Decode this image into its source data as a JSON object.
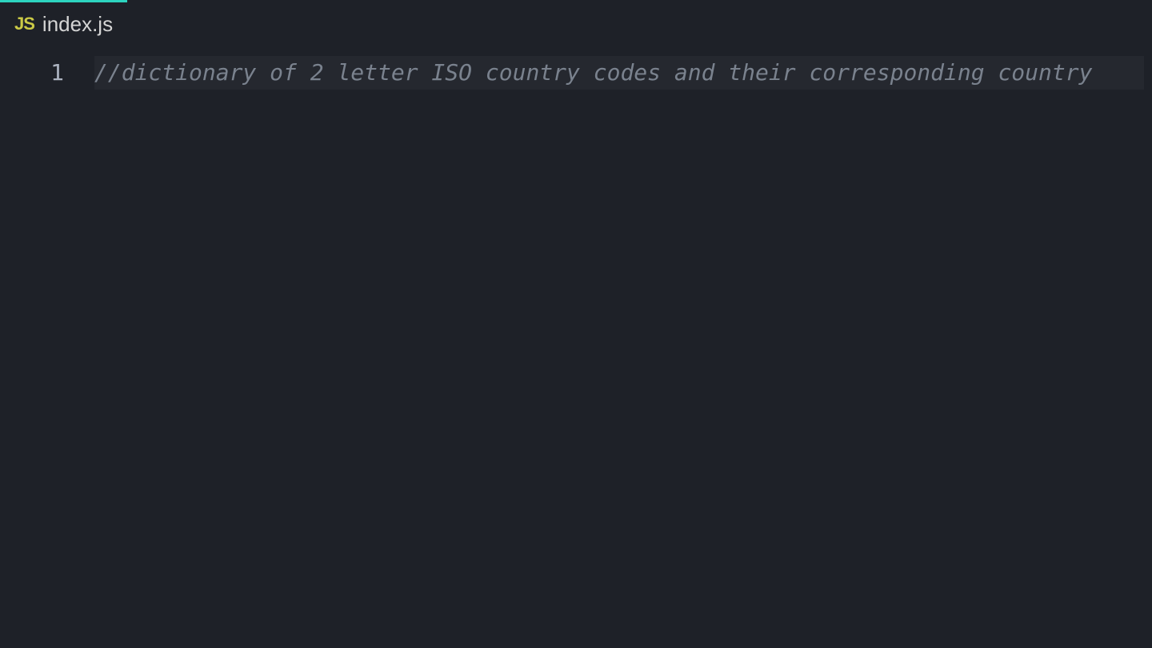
{
  "tab": {
    "icon_label": "JS",
    "filename": "index.js"
  },
  "editor": {
    "lines": [
      {
        "number": "1",
        "content": "//dictionary of 2 letter ISO country codes and their corresponding country"
      }
    ]
  }
}
